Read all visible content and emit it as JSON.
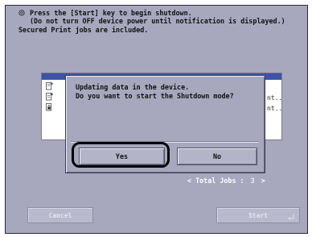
{
  "message": {
    "icon": "stop-icon",
    "line1": "Press the [Start] key to begin shutdown.",
    "line2": "(Do not turn OFF device power until notification is displayed.)",
    "line3": "Secured Print jobs are included."
  },
  "job_list": {
    "rows": [
      {
        "icon": "document-arrow-icon",
        "text": ""
      },
      {
        "icon": "document-gear-icon",
        "text": "nt.."
      },
      {
        "icon": "document-lock-icon",
        "text": "nt.."
      }
    ]
  },
  "total_jobs": {
    "prefix": "<",
    "label": "Total Jobs :",
    "count": "3",
    "arrow": ">"
  },
  "dialog": {
    "line1": "Updating data in the device.",
    "line2": "Do you want to start the Shutdown mode?",
    "yes_label": "Yes",
    "no_label": "No"
  },
  "buttons": {
    "cancel_label": "Cancel",
    "start_label": "Start"
  },
  "colors": {
    "panel": "#a7a7bd",
    "header_blue": "#3d52a9",
    "focus_ring": "#000000"
  }
}
